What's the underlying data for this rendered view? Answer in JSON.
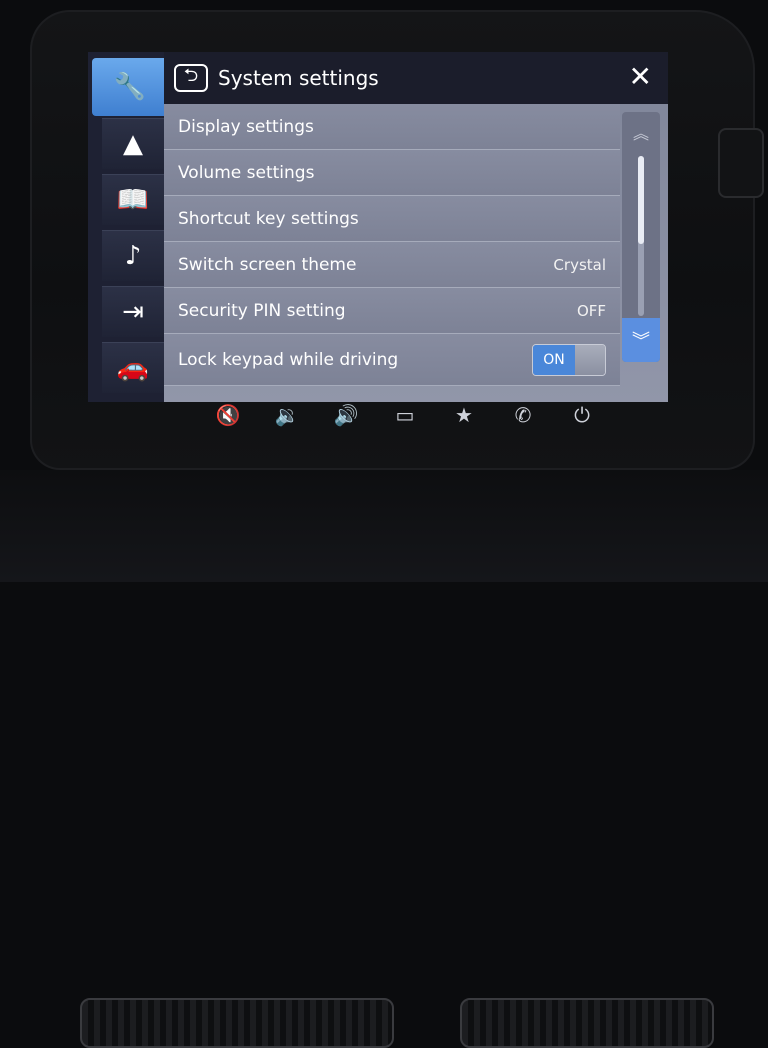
{
  "header": {
    "title": "System settings",
    "back_icon": "back-arrow-icon",
    "close_icon": "close-icon",
    "close_glyph": "✕",
    "back_glyph": "⮌"
  },
  "sidebar": {
    "items": [
      {
        "icon": "tools-icon",
        "glyph": "🔧",
        "active": true
      },
      {
        "icon": "navigation-arrow-icon",
        "glyph": "▲",
        "active": false
      },
      {
        "icon": "map-book-icon",
        "glyph": "📖",
        "active": false
      },
      {
        "icon": "music-note-icon",
        "glyph": "♪",
        "active": false
      },
      {
        "icon": "phone-projection-icon",
        "glyph": "⇥",
        "active": false
      },
      {
        "icon": "car-icon",
        "glyph": "🚗",
        "active": false
      }
    ]
  },
  "settings": {
    "rows": [
      {
        "label": "Display settings",
        "value": ""
      },
      {
        "label": "Volume settings",
        "value": ""
      },
      {
        "label": "Shortcut key settings",
        "value": ""
      },
      {
        "label": "Switch screen theme",
        "value": "Crystal"
      },
      {
        "label": "Security PIN setting",
        "value": "OFF"
      },
      {
        "label": "Lock keypad while driving",
        "toggle": "ON"
      }
    ]
  },
  "scrollbar": {
    "up_glyph": "︽",
    "down_glyph": "︾",
    "position_fraction": 0.0,
    "visible_fraction": 0.55
  },
  "hardkeys": [
    {
      "icon": "mute-icon",
      "glyph": "🔇"
    },
    {
      "icon": "volume-down-icon",
      "glyph": "🔉"
    },
    {
      "icon": "volume-up-icon",
      "glyph": "🔊"
    },
    {
      "icon": "screen-icon",
      "glyph": "▭"
    },
    {
      "icon": "star-icon",
      "glyph": "★"
    },
    {
      "icon": "phone-icon",
      "glyph": "✆"
    },
    {
      "icon": "power-icon",
      "glyph": "⏻"
    }
  ],
  "colors": {
    "accent": "#4a87d9",
    "active_tab": "#5a9be6"
  }
}
